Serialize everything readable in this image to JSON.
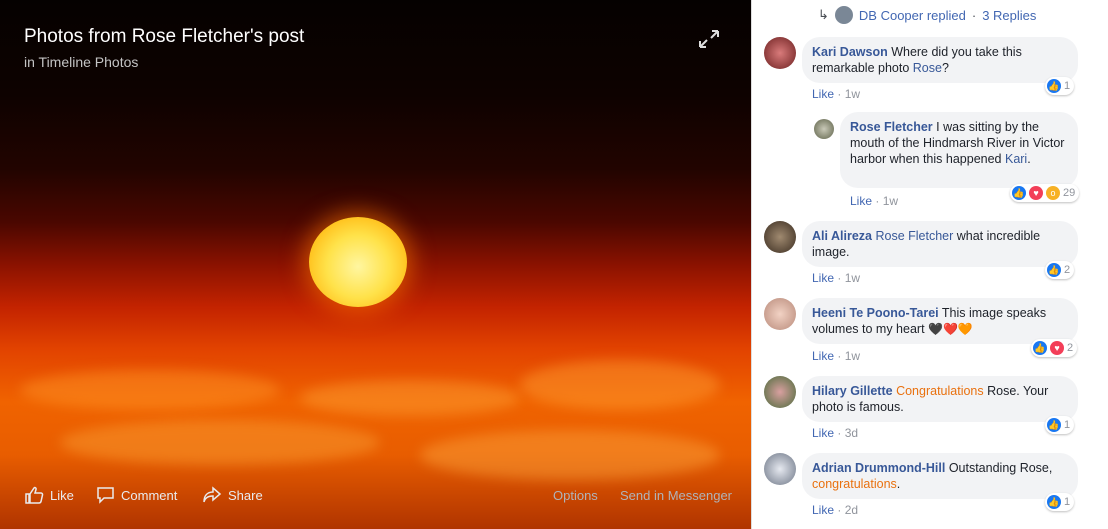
{
  "photo": {
    "title": "Photos from Rose Fletcher's post",
    "subtitle": "in Timeline Photos",
    "actions": {
      "like": "Like",
      "comment": "Comment",
      "share": "Share",
      "options": "Options",
      "send": "Send in Messenger"
    }
  },
  "replied": {
    "author": "DB Cooper replied",
    "sep": "·",
    "replies": "3 Replies"
  },
  "comments": [
    {
      "author": "Kari Dawson",
      "text": " Where did you take this remarkable photo ",
      "mention": "Rose",
      "tail": "?",
      "like": "Like",
      "time": "1w",
      "count": "1"
    },
    {
      "author": "Rose Fletcher",
      "text": " I was sitting by the mouth of the Hindmarsh River in Victor harbor when this happened ",
      "mention": "Kari",
      "tail": ".",
      "like": "Like",
      "time": "1w",
      "count": "29"
    },
    {
      "author": "Ali Alireza",
      "mention": "Rose Fletcher",
      "text": " what incredible image.",
      "like": "Like",
      "time": "1w",
      "count": "2"
    },
    {
      "author": "Heeni Te Poono-Tarei",
      "text": " This image speaks volumes to my heart ",
      "emoji": "🖤❤️🧡",
      "like": "Like",
      "time": "1w",
      "count": "2"
    },
    {
      "author": "Hilary Gillette",
      "mention": "Congratulations",
      "text": " Rose. Your photo is famous.",
      "like": "Like",
      "time": "3d",
      "count": "1"
    },
    {
      "author": "Adrian Drummond-Hill",
      "text": " Outstanding Rose, ",
      "mention": "congratulations",
      "tail": ".",
      "like": "Like",
      "time": "2d",
      "count": "1"
    }
  ],
  "meta_sep": " · "
}
